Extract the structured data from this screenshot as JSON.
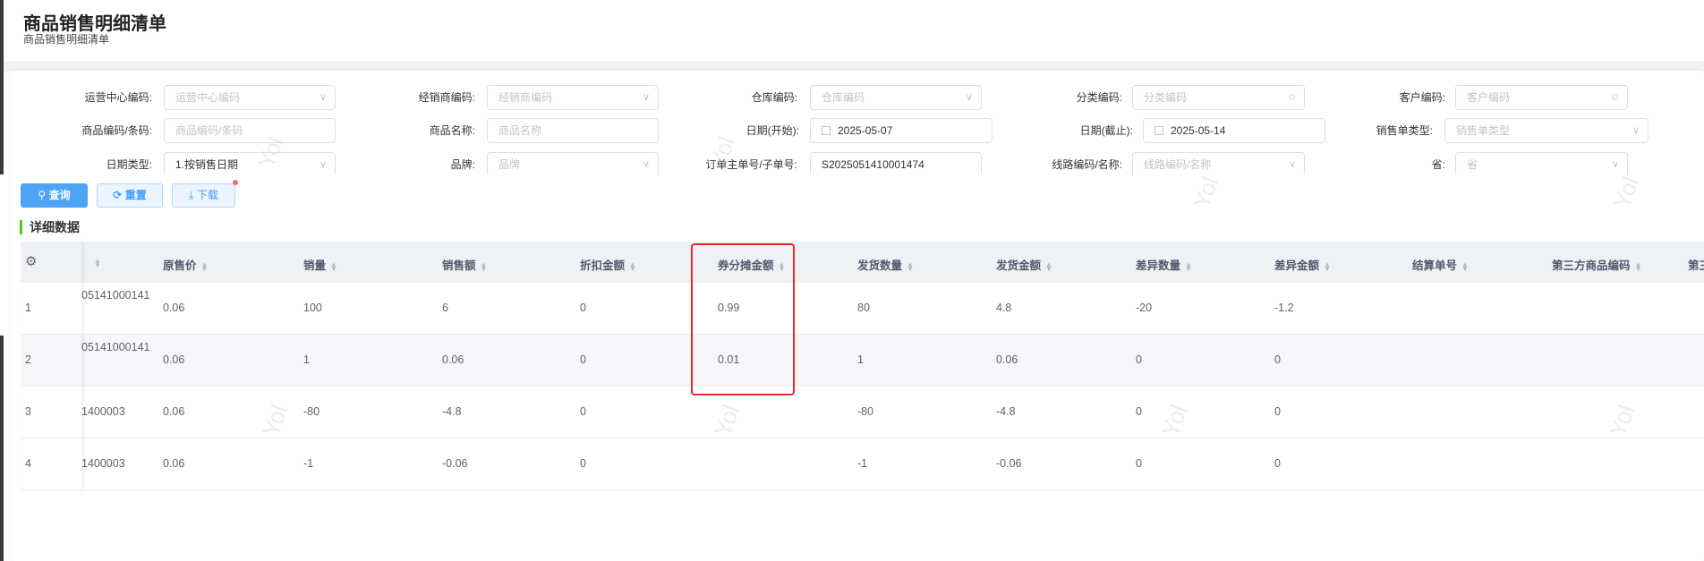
{
  "page": {
    "title": "商品销售明细清单",
    "subtitle": "商品销售明细清单"
  },
  "filters": [
    {
      "label": "运营中心编码:",
      "placeholder": "运营中心编码",
      "value": "",
      "type": "select"
    },
    {
      "label": "经销商编码:",
      "placeholder": "经销商编码",
      "value": "",
      "type": "select"
    },
    {
      "label": "仓库编码:",
      "placeholder": "仓库编码",
      "value": "",
      "type": "select"
    },
    {
      "label": "分类编码:",
      "placeholder": "分类编码",
      "value": "",
      "type": "search"
    },
    {
      "label": "客户编码:",
      "placeholder": "客户编码",
      "value": "",
      "type": "search"
    },
    {
      "label": "商品编码/条码:",
      "placeholder": "商品编码/条码",
      "value": "",
      "type": "input"
    },
    {
      "label": "商品名称:",
      "placeholder": "商品名称",
      "value": "",
      "type": "input"
    },
    {
      "label": "日期(开始):",
      "placeholder": "",
      "value": "2025-05-07",
      "type": "date"
    },
    {
      "label": "日期(截止):",
      "placeholder": "",
      "value": "2025-05-14",
      "type": "date"
    },
    {
      "label": "销售单类型:",
      "placeholder": "销售单类型",
      "value": "",
      "type": "select"
    },
    {
      "label": "日期类型:",
      "placeholder": "",
      "value": "1.按销售日期",
      "type": "select"
    },
    {
      "label": "品牌:",
      "placeholder": "品牌",
      "value": "",
      "type": "select"
    },
    {
      "label": "订单主单号/子单号:",
      "placeholder": "",
      "value": "S2025051410001474",
      "type": "input"
    },
    {
      "label": "线路编码/名称:",
      "placeholder": "线路编码/名称",
      "value": "",
      "type": "select"
    },
    {
      "label": "省:",
      "placeholder": "省",
      "value": "",
      "type": "select"
    }
  ],
  "buttons": {
    "query": "查询",
    "reset": "重置",
    "download": "下载"
  },
  "section_title": "详细数据",
  "table": {
    "columns": [
      "",
      "原售价",
      "销量",
      "销售额",
      "折扣金额",
      "券分摊金额",
      "发货数量",
      "发货金额",
      "差异数量",
      "差异金额",
      "结算单号",
      "第三方商品编码",
      "第三"
    ],
    "rows": [
      {
        "index": "1",
        "cells": [
          "05141000141",
          "0.06",
          "100",
          "6",
          "0",
          "0.99",
          "80",
          "4.8",
          "-20",
          "-1.2",
          "",
          "",
          ""
        ]
      },
      {
        "index": "2",
        "cells": [
          "05141000141",
          "0.06",
          "1",
          "0.06",
          "0",
          "0.01",
          "1",
          "0.06",
          "0",
          "0",
          "",
          "",
          ""
        ]
      },
      {
        "index": "3",
        "cells": [
          "1400003",
          "0.06",
          "-80",
          "-4.8",
          "0",
          "",
          "-80",
          "-4.8",
          "0",
          "0",
          "",
          "",
          ""
        ]
      },
      {
        "index": "4",
        "cells": [
          "1400003",
          "0.06",
          "-1",
          "-0.06",
          "0",
          "",
          "-1",
          "-0.06",
          "0",
          "0",
          "",
          "",
          ""
        ]
      }
    ],
    "highlighted_column": "券分摊金额"
  },
  "watermark": "Yol",
  "colors": {
    "primary": "#409eff",
    "highlight": "#f0262a",
    "section_bar": "#52c41a"
  }
}
